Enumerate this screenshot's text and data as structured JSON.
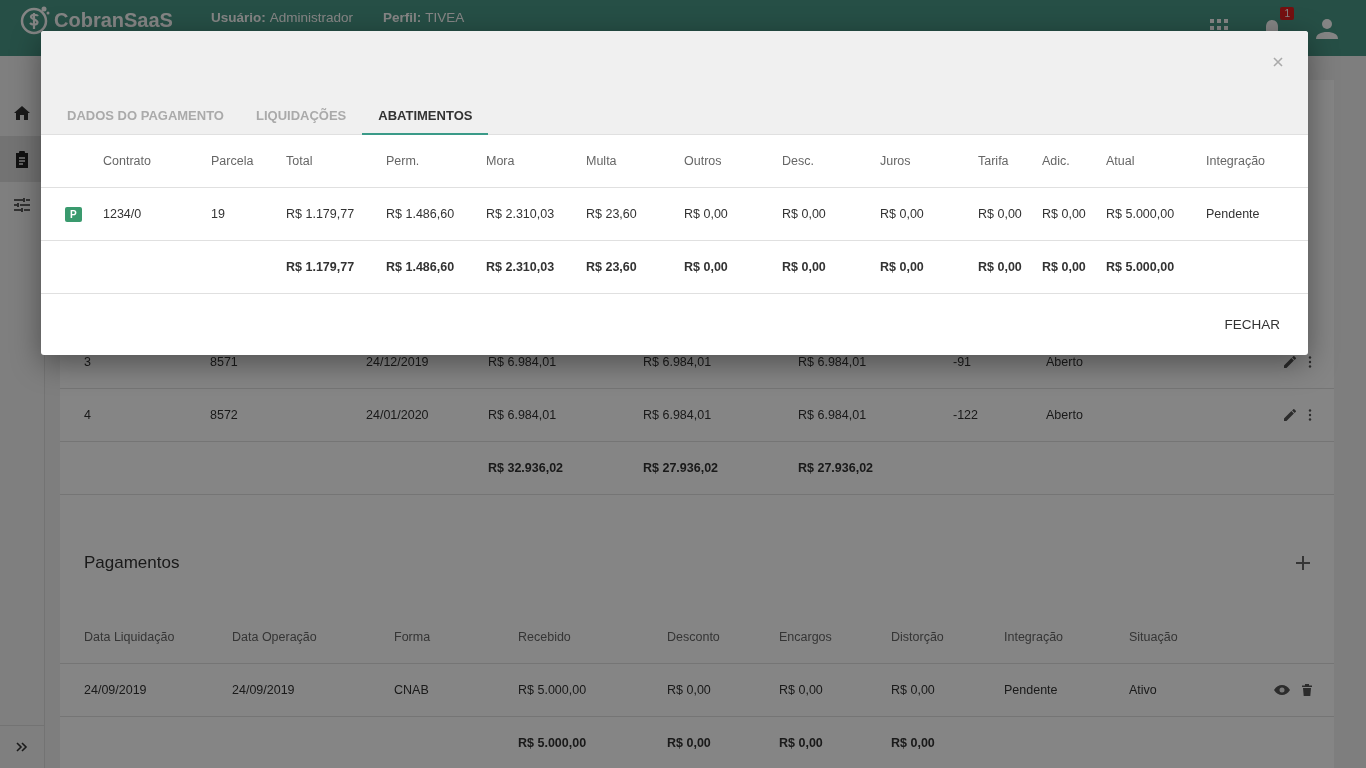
{
  "app_bar": {
    "logo": "CobranSaaS",
    "user_label": "Usuário:",
    "user": "Administrador",
    "profile_label": "Perfil:",
    "profile": "TIVEA",
    "notification_count": "1"
  },
  "sidebar": {
    "items": [
      {
        "selected": false
      },
      {
        "selected": true
      },
      {
        "selected": false
      }
    ]
  },
  "installments": {
    "rows": [
      {
        "cells": [
          "3",
          "8571",
          "24/12/2019",
          "R$ 6.984,01",
          "R$ 6.984,01",
          "R$ 6.984,01",
          "-91",
          "Aberto"
        ]
      },
      {
        "cells": [
          "4",
          "8572",
          "24/01/2020",
          "R$ 6.984,01",
          "R$ 6.984,01",
          "R$ 6.984,01",
          "-122",
          "Aberto"
        ]
      }
    ],
    "totals": [
      "R$ 32.936,02",
      "R$ 27.936,02",
      "R$ 27.936,02"
    ]
  },
  "payments": {
    "title": "Pagamentos",
    "columns": [
      "Data Liquidação",
      "Data Operação",
      "Forma",
      "Recebido",
      "Desconto",
      "Encargos",
      "Distorção",
      "Integração",
      "Situação"
    ],
    "rows": [
      {
        "cells": [
          "24/09/2019",
          "24/09/2019",
          "CNAB",
          "R$ 5.000,00",
          "R$ 0,00",
          "R$ 0,00",
          "R$ 0,00",
          "Pendente",
          "Ativo"
        ]
      }
    ],
    "totals": [
      "R$ 5.000,00",
      "R$ 0,00",
      "R$ 0,00",
      "R$ 0,00"
    ]
  },
  "modal": {
    "tabs": [
      {
        "label": "DADOS DO PAGAMENTO",
        "selected": false
      },
      {
        "label": "LIQUIDAÇÕES",
        "selected": false
      },
      {
        "label": "ABATIMENTOS",
        "selected": true
      }
    ],
    "columns": [
      "Contrato",
      "Parcela",
      "Total",
      "Perm.",
      "Mora",
      "Multa",
      "Outros",
      "Desc.",
      "Juros",
      "Tarifa",
      "Adic.",
      "Atual",
      "Integração"
    ],
    "rows": [
      {
        "badge": "P",
        "cells": [
          "1234/0",
          "19",
          "R$ 1.179,77",
          "R$ 1.486,60",
          "R$ 2.310,03",
          "R$ 23,60",
          "R$ 0,00",
          "R$ 0,00",
          "R$ 0,00",
          "R$ 0,00",
          "R$ 0,00",
          "R$ 5.000,00",
          "Pendente"
        ]
      }
    ],
    "totals": [
      "R$ 1.179,77",
      "R$ 1.486,60",
      "R$ 2.310,03",
      "R$ 23,60",
      "R$ 0,00",
      "R$ 0,00",
      "R$ 0,00",
      "R$ 0,00",
      "R$ 0,00",
      "R$ 5.000,00"
    ],
    "close_button": "FECHAR"
  }
}
